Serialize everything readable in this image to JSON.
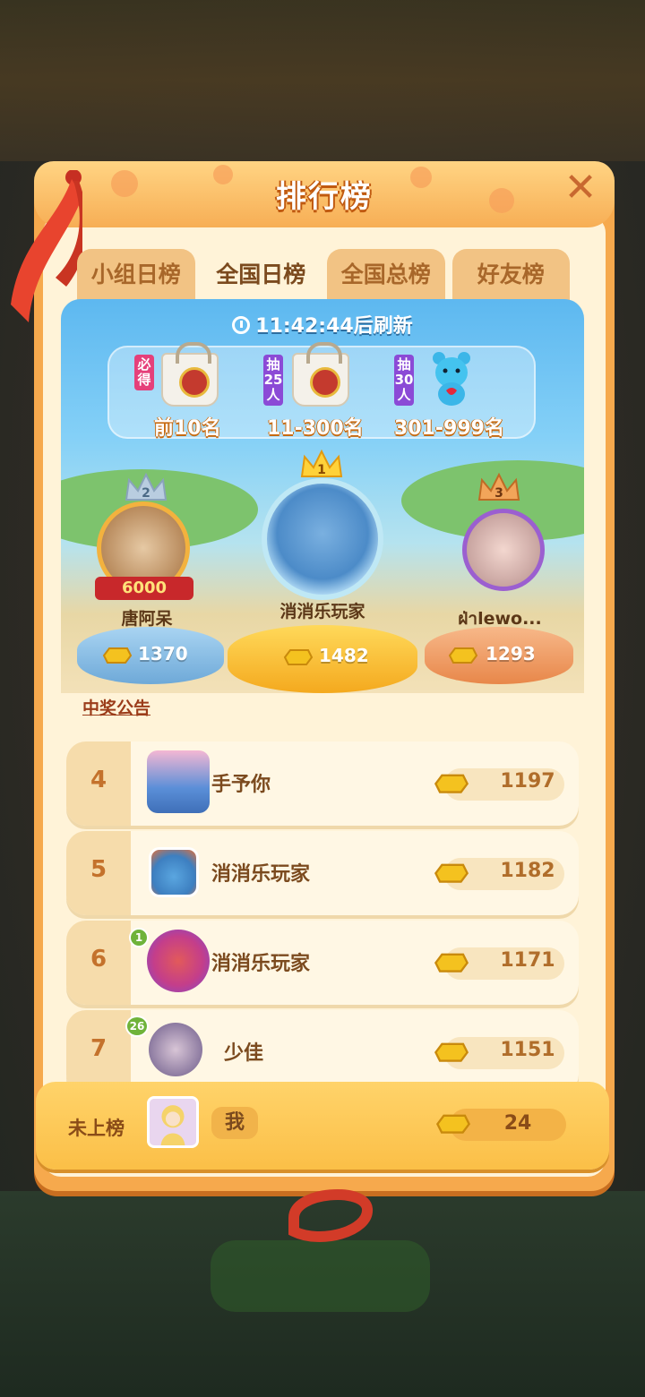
{
  "panel": {
    "title": "排行榜",
    "close_icon": "close-icon"
  },
  "tabs": [
    {
      "label": "小组日榜",
      "active": false
    },
    {
      "label": "全国日榜",
      "active": true
    },
    {
      "label": "全国总榜",
      "active": false
    },
    {
      "label": "好友榜",
      "active": false
    }
  ],
  "refresh": {
    "time": "11:42:44",
    "suffix": "后刷新"
  },
  "prizes": [
    {
      "tag": "必得",
      "range": "前10名",
      "icon": "gift-bag-icon"
    },
    {
      "tag": "抽25人",
      "range": "11-300名",
      "icon": "gift-bag-icon"
    },
    {
      "tag": "抽30人",
      "range": "301-999名",
      "icon": "blue-bear-icon"
    }
  ],
  "top3": [
    {
      "rank": "2",
      "name": "唐阿呆",
      "score": "1370",
      "badge": "6000"
    },
    {
      "rank": "1",
      "name": "消消乐玩家",
      "score": "1482"
    },
    {
      "rank": "3",
      "name": "ฝ่าlewo...",
      "score": "1293"
    }
  ],
  "notice_link": "中奖公告",
  "rows": [
    {
      "rank": "4",
      "name": "手予你",
      "score": "1197"
    },
    {
      "rank": "5",
      "name": "消消乐玩家",
      "score": "1182"
    },
    {
      "rank": "6",
      "name": "消消乐玩家",
      "score": "1171",
      "level": "1"
    },
    {
      "rank": "7",
      "name": "少佳",
      "score": "1151",
      "level": "26"
    }
  ],
  "mine": {
    "label": "未上榜",
    "name": "我",
    "score": "24"
  },
  "colors": {
    "panel_orange": "#f6a94d",
    "inner_cream": "#fff3d8",
    "brown_text": "#7b4a1e",
    "banner_blue": "#5db8f0"
  }
}
